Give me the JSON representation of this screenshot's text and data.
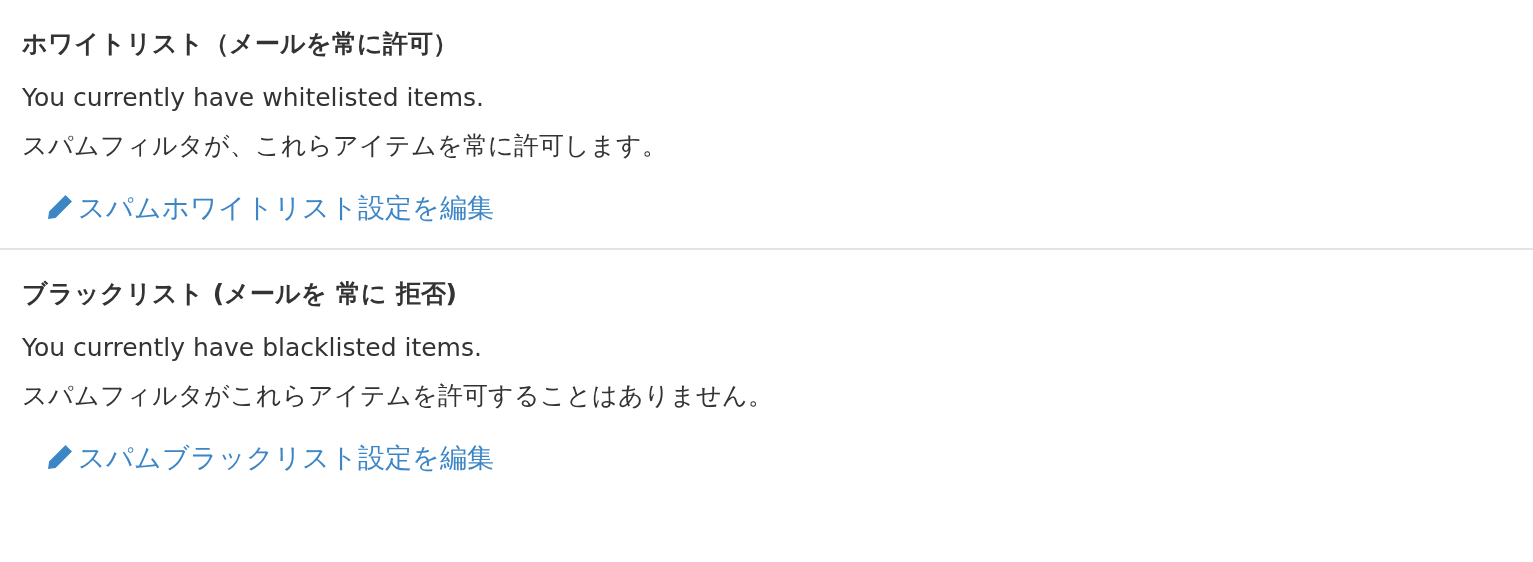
{
  "sections": [
    {
      "heading": "ホワイトリスト（メールを常に許可）",
      "status": "You currently have whitelisted items.",
      "description": "スパムフィルタが、これらアイテムを常に許可します。",
      "edit_link": "スパムホワイトリスト設定を編集"
    },
    {
      "heading": "ブラックリスト (メールを 常に 拒否)",
      "status": "You currently have blacklisted items.",
      "description": "スパムフィルタがこれらアイテムを許可することはありません。",
      "edit_link": "スパムブラックリスト設定を編集"
    }
  ]
}
